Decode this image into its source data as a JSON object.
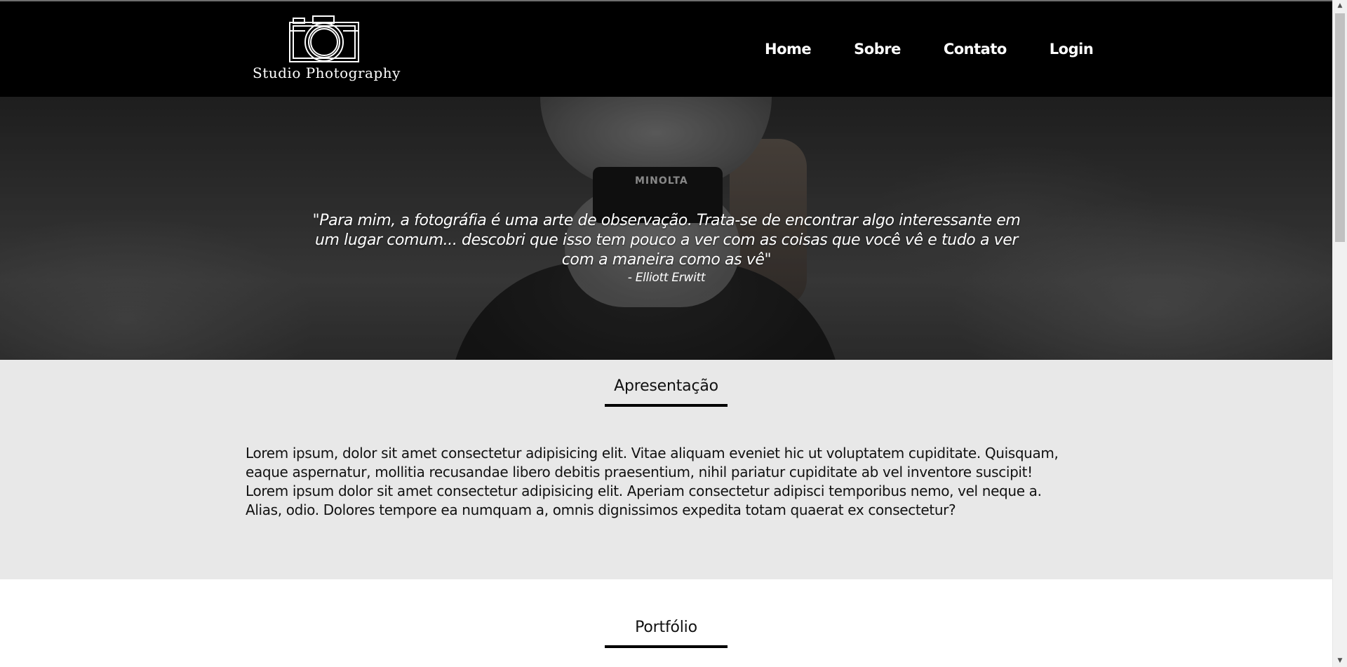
{
  "header": {
    "logo_text": "Studio Photography",
    "logo_icon": "camera-icon",
    "nav": [
      {
        "label": "Home"
      },
      {
        "label": "Sobre"
      },
      {
        "label": "Contato"
      },
      {
        "label": "Login"
      }
    ]
  },
  "hero": {
    "camera_brand": "MINOLTA",
    "quote": "\"Para mim, a fotográfia é uma arte de observação. Trata-se de encontrar algo interessante em um lugar comum... descobri que isso tem pouco a ver com as coisas que você vê e tudo a ver com a maneira como as vê\"",
    "author": "- Elliott Erwitt"
  },
  "about": {
    "title": "Apresentação",
    "text": "Lorem ipsum, dolor sit amet consectetur adipisicing elit. Vitae aliquam eveniet hic ut voluptatem cupiditate. Quisquam, eaque aspernatur, mollitia recusandae libero debitis praesentium, nihil pariatur cupiditate ab vel inventore suscipit! Lorem ipsum dolor sit amet consectetur adipisicing elit. Aperiam consectetur adipisci temporibus nemo, vel neque a. Alias, odio. Dolores tempore ea numquam a, omnis dignissimos expedita totam quaerat ex consectetur?"
  },
  "portfolio": {
    "title": "Portfólio"
  },
  "colors": {
    "header_bg": "#000000",
    "about_bg": "#e8e8e8",
    "portfolio_bg": "#ffffff",
    "accent": "#000000"
  }
}
